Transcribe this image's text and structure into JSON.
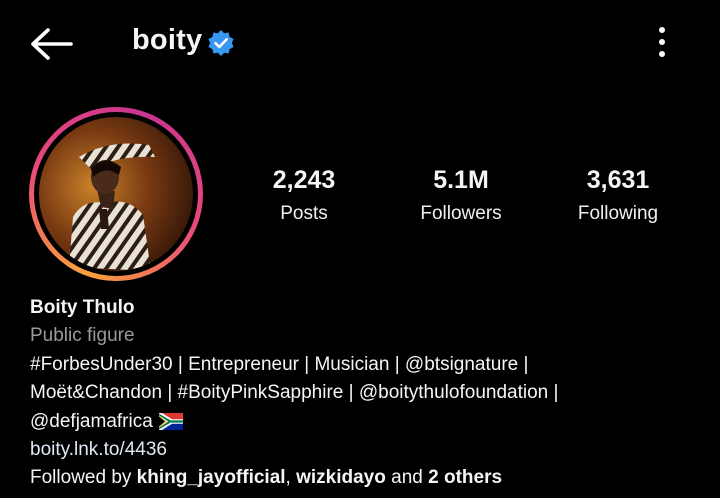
{
  "header": {
    "username": "boity"
  },
  "stats": [
    {
      "value": "2,243",
      "label": "Posts"
    },
    {
      "value": "5.1M",
      "label": "Followers"
    },
    {
      "value": "3,631",
      "label": "Following"
    }
  ],
  "bio": {
    "full_name": "Boity Thulo",
    "category": "Public figure",
    "line1": "#ForbesUnder30 | Entrepreneur | Musician | @btsignature |",
    "line2": "Moët&Chandon | #BoityPinkSapphire | @boitythulofoundation |",
    "line3": "@defjamafrica",
    "link": "boity.lnk.to/4436",
    "followed_by_prefix": "Followed by ",
    "followed_user1": "khing_jayofficial",
    "separator": ", ",
    "followed_user2": "wizkidayo",
    "and_text": " and ",
    "others": "2 others"
  },
  "icons": {
    "back": "arrow-left-icon",
    "verified": "verified-badge-icon",
    "more": "more-vertical-icon",
    "flag": "south-africa-flag-icon"
  },
  "colors": {
    "background": "#000000",
    "verified_blue": "#3897f0",
    "category_gray": "#9a9a9a",
    "ring_start": "#f9a23b",
    "ring_end": "#c7358f"
  }
}
